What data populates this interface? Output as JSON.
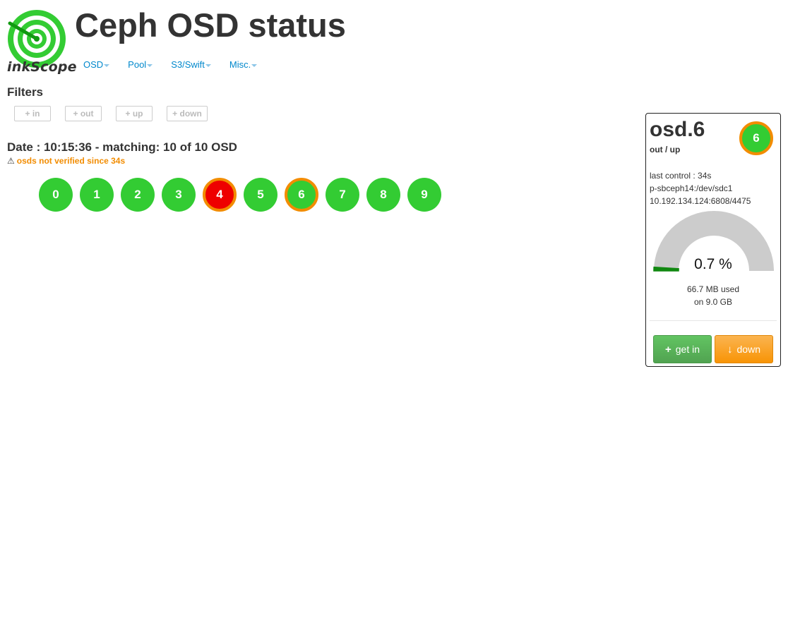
{
  "header": {
    "logo_text": "inkScope",
    "title": "Ceph OSD status"
  },
  "nav": {
    "items": [
      "OSD",
      "Pool",
      "S3/Swift",
      "Misc."
    ]
  },
  "filters": {
    "title": "Filters",
    "buttons": [
      "+ in",
      "+ out",
      "+ up",
      "+ down"
    ]
  },
  "status": {
    "date_line": "Date : 10:15:36 - matching: 10 of 10 OSD",
    "warning": "osds not verified since 34s",
    "warning_icon": "warning-triangle-icon"
  },
  "osds": [
    {
      "id": "0",
      "state": "up-in"
    },
    {
      "id": "1",
      "state": "up-in"
    },
    {
      "id": "2",
      "state": "up-in"
    },
    {
      "id": "3",
      "state": "up-in"
    },
    {
      "id": "4",
      "state": "down-out"
    },
    {
      "id": "5",
      "state": "up-in"
    },
    {
      "id": "6",
      "state": "up-out"
    },
    {
      "id": "7",
      "state": "up-in"
    },
    {
      "id": "8",
      "state": "up-in"
    },
    {
      "id": "9",
      "state": "up-in"
    }
  ],
  "detail": {
    "name": "osd.6",
    "state": "out / up",
    "badge": "6",
    "last_control": "last control : 34s",
    "host_device": "p-sbceph14:/dev/sdc1",
    "address": "10.192.134.124:6808/4475",
    "gauge_value": "0.7 %",
    "gauge_fraction": 0.007,
    "used": "66.7 MB used",
    "total": "on 9.0 GB",
    "get_in_label": "get in",
    "down_label": "down",
    "get_in_icon": "plus-icon",
    "down_icon": "arrow-down-icon"
  },
  "colors": {
    "up": "#33cc33",
    "down": "#ee0000",
    "out_ring": "#f28c00",
    "link": "#0088cc",
    "warning": "#f28c00",
    "gauge_track": "#cccccc",
    "gauge_fill": "#118811"
  }
}
